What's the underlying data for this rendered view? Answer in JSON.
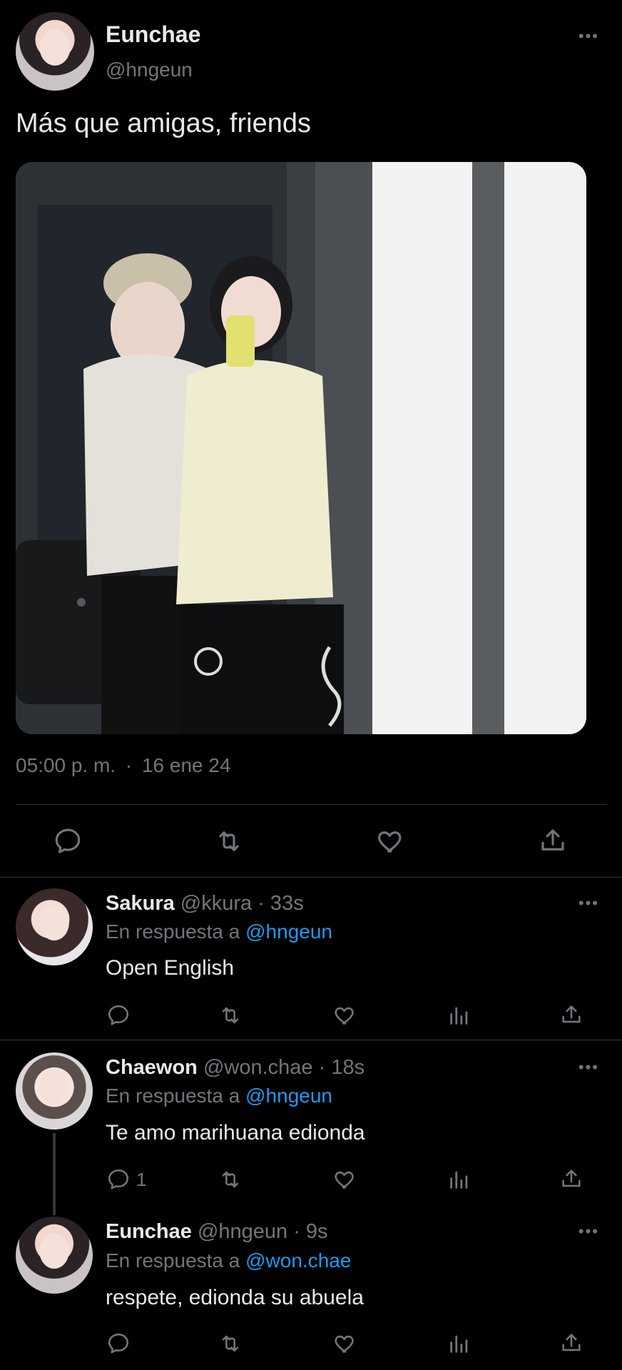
{
  "main_tweet": {
    "author_name": "Eunchae",
    "author_handle": "@hngeun",
    "text": "Más que amigas, friends",
    "timestamp": "05:00 p. m.",
    "separator": "·",
    "date": "16 ene 24"
  },
  "replies": [
    {
      "name": "Sakura",
      "handle": "@kkura",
      "time": "· 33s",
      "reply_prefix": "En respuesta a",
      "reply_to": "@hngeun",
      "text": "Open English",
      "reply_count": ""
    },
    {
      "name": "Chaewon",
      "handle": "@won.chae",
      "time": "· 18s",
      "reply_prefix": "En respuesta a",
      "reply_to": "@hngeun",
      "text": "Te amo marihuana edionda",
      "reply_count": "1"
    },
    {
      "name": "Eunchae",
      "handle": "@hngeun",
      "time": "· 9s",
      "reply_prefix": "En respuesta a",
      "reply_to": "@won.chae",
      "text": "respete, edionda su abuela",
      "reply_count": ""
    }
  ],
  "icons": {
    "more": "more-icon",
    "reply": "reply-icon",
    "retweet": "retweet-icon",
    "like": "like-icon",
    "views": "views-icon",
    "share": "share-icon"
  },
  "colors": {
    "background": "#000000",
    "text": "#e7e9ea",
    "muted": "#71767b",
    "link": "#1d9bf0",
    "divider": "#2f3336"
  }
}
